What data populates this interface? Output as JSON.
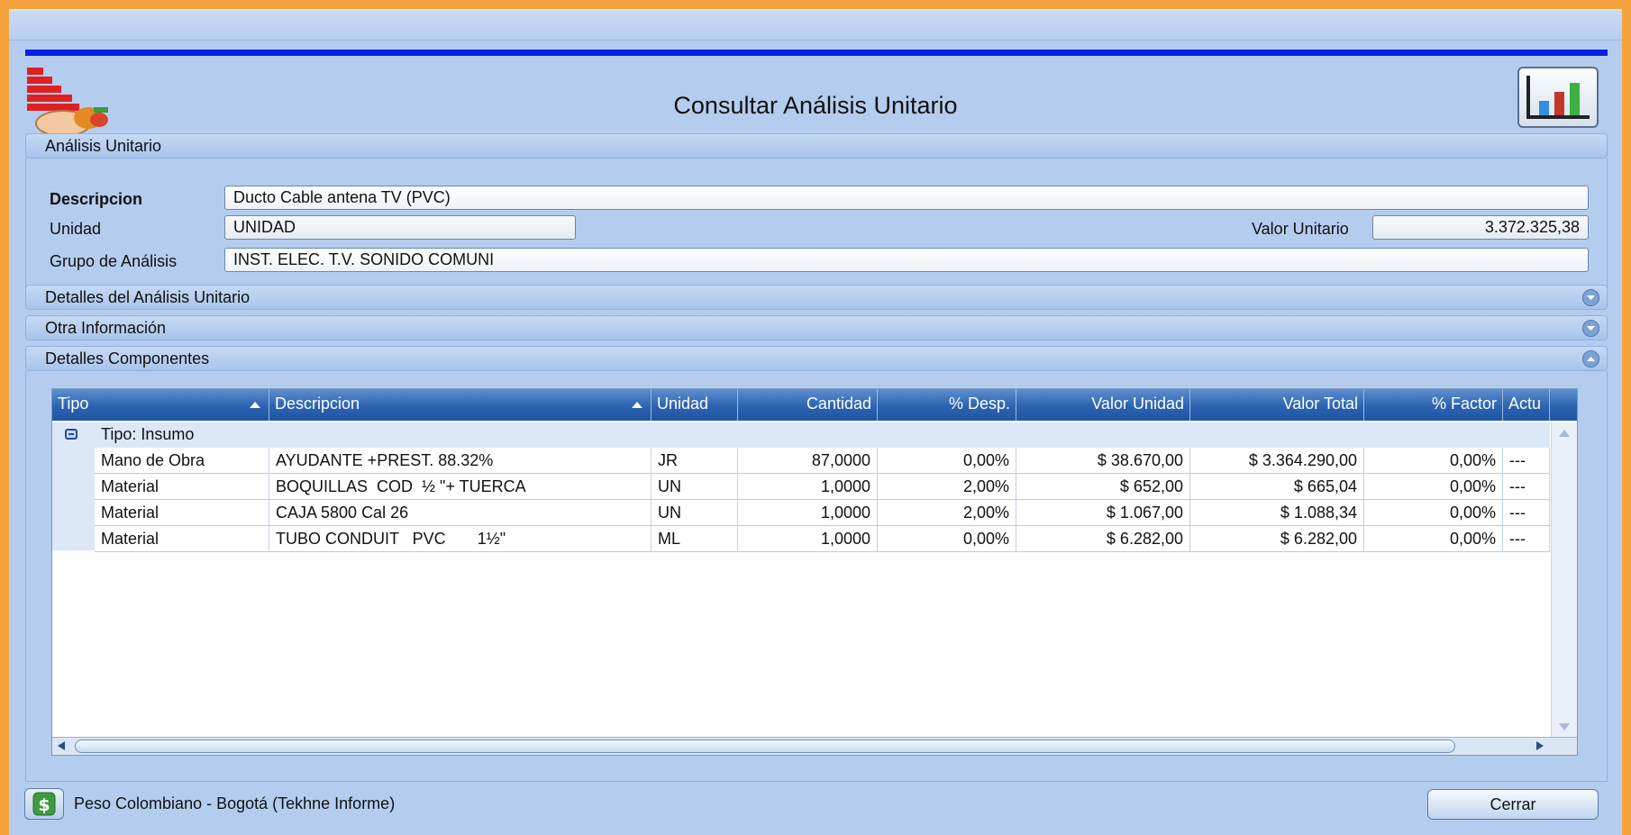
{
  "window": {
    "title": "Consultar Análisis Unitario"
  },
  "colors": {
    "accent_rule": "#0d1ee6",
    "grid_header": "#2c63b0",
    "background": "#b4cdef",
    "frame": "#f7a33d"
  },
  "icons": {
    "logo": "app-logo-icon",
    "chart": "bar-chart-icon",
    "currency": "dollar-icon",
    "collapse": "chevron-down-icon",
    "expand": "chevron-up-icon"
  },
  "sections": {
    "analisis": "Análisis Unitario",
    "detalles_analisis": "Detalles del Análisis Unitario",
    "otra_info": "Otra Información",
    "detalles_componentes": "Detalles Componentes"
  },
  "form": {
    "descripcion_label": "Descripcion",
    "descripcion_value": "Ducto Cable antena TV (PVC)",
    "unidad_label": "Unidad",
    "unidad_value": "UNIDAD",
    "valor_unitario_label": "Valor Unitario",
    "valor_unitario_value": "3.372.325,38",
    "grupo_label": "Grupo de Análisis",
    "grupo_value": "INST. ELEC. T.V. SONIDO COMUNI"
  },
  "grid": {
    "columns": [
      "Tipo",
      "Descripcion",
      "Unidad",
      "Cantidad",
      "% Desp.",
      "Valor Unidad",
      "Valor Total",
      "% Factor",
      "Actu"
    ],
    "group_label": "Tipo: Insumo",
    "rows": [
      {
        "tipo": "Mano de Obra",
        "descripcion": "AYUDANTE +PREST. 88.32%",
        "unidad": "JR",
        "cantidad": "87,0000",
        "desp": "0,00%",
        "valor_unidad": "$ 38.670,00",
        "valor_total": "$ 3.364.290,00",
        "factor": "0,00%",
        "actu": "---"
      },
      {
        "tipo": "Material",
        "descripcion": "BOQUILLAS  COD  ½ \"+ TUERCA",
        "unidad": "UN",
        "cantidad": "1,0000",
        "desp": "2,00%",
        "valor_unidad": "$ 652,00",
        "valor_total": "$ 665,04",
        "factor": "0,00%",
        "actu": "---"
      },
      {
        "tipo": "Material",
        "descripcion": "CAJA 5800 Cal 26",
        "unidad": "UN",
        "cantidad": "1,0000",
        "desp": "2,00%",
        "valor_unidad": "$ 1.067,00",
        "valor_total": "$ 1.088,34",
        "factor": "0,00%",
        "actu": "---"
      },
      {
        "tipo": "Material",
        "descripcion": "TUBO CONDUIT   PVC       1½\"",
        "unidad": "ML",
        "cantidad": "1,0000",
        "desp": "0,00%",
        "valor_unidad": "$ 6.282,00",
        "valor_total": "$ 6.282,00",
        "factor": "0,00%",
        "actu": "---"
      }
    ]
  },
  "footer": {
    "currency_text": "Peso Colombiano - Bogotá (Tekhne Informe)",
    "close_label": "Cerrar"
  }
}
